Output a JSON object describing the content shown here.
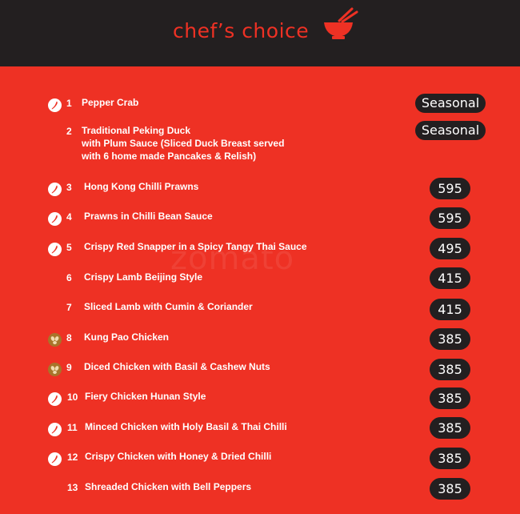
{
  "header": {
    "title": "chef’s choice",
    "icon": "bowl-with-chopsticks"
  },
  "watermark": "zomato",
  "colors": {
    "background": "#ee3124",
    "header": "#231f20",
    "badge": "#231f20",
    "nut": "#a8742a"
  },
  "items": [
    {
      "num": "1",
      "lines": [
        "Pepper Crab"
      ],
      "price": "Seasonal",
      "icon": "spicy-chilli-icon"
    },
    {
      "num": "2",
      "lines": [
        "Traditional Peking Duck",
        "with Plum Sauce (Sliced Duck Breast served",
        "with 6 home made Pancakes & Relish)"
      ],
      "price": "Seasonal",
      "icon": ""
    },
    {
      "num": "3",
      "lines": [
        "Hong Kong Chilli Prawns"
      ],
      "price": "595",
      "icon": "spicy-chilli-icon"
    },
    {
      "num": "4",
      "lines": [
        "Prawns in Chilli Bean Sauce"
      ],
      "price": "595",
      "icon": "spicy-chilli-icon"
    },
    {
      "num": "5",
      "lines": [
        "Crispy Red Snapper in a Spicy Tangy Thai Sauce"
      ],
      "price": "495",
      "icon": "spicy-chilli-icon"
    },
    {
      "num": "6",
      "lines": [
        "Crispy Lamb Beijing Style"
      ],
      "price": "415",
      "icon": ""
    },
    {
      "num": "7",
      "lines": [
        "Sliced Lamb with Cumin & Coriander"
      ],
      "price": "415",
      "icon": ""
    },
    {
      "num": "8",
      "lines": [
        "Kung Pao Chicken"
      ],
      "price": "385",
      "icon": "nut-icon"
    },
    {
      "num": "9",
      "lines": [
        "Diced Chicken with Basil & Cashew Nuts"
      ],
      "price": "385",
      "icon": "nut-icon"
    },
    {
      "num": "10",
      "lines": [
        "Fiery Chicken Hunan Style"
      ],
      "price": "385",
      "icon": "spicy-chilli-icon"
    },
    {
      "num": "11",
      "lines": [
        "Minced Chicken with Holy Basil & Thai Chilli"
      ],
      "price": "385",
      "icon": "spicy-chilli-icon"
    },
    {
      "num": "12",
      "lines": [
        "Crispy Chicken with Honey & Dried Chilli"
      ],
      "price": "385",
      "icon": "spicy-chilli-icon"
    },
    {
      "num": "13",
      "lines": [
        "Shreaded Chicken with Bell Peppers"
      ],
      "price": "385",
      "icon": ""
    }
  ]
}
